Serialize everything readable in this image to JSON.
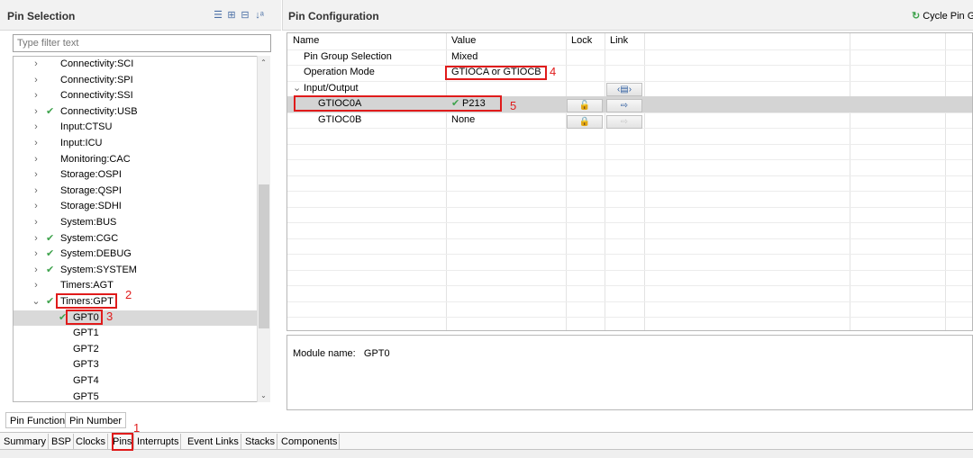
{
  "pin_selection": {
    "title": "Pin Selection",
    "toolbar_icons": [
      "collapse-all-icon",
      "expand-icon",
      "collapse-icon",
      "sort-az-icon"
    ],
    "filter_placeholder": "Type filter text",
    "tree": [
      {
        "label": "Connectivity:SCI",
        "expanded": false,
        "checked": false,
        "level": 0
      },
      {
        "label": "Connectivity:SPI",
        "expanded": false,
        "checked": false,
        "level": 0
      },
      {
        "label": "Connectivity:SSI",
        "expanded": false,
        "checked": false,
        "level": 0
      },
      {
        "label": "Connectivity:USB",
        "expanded": false,
        "checked": true,
        "level": 0
      },
      {
        "label": "Input:CTSU",
        "expanded": false,
        "checked": false,
        "level": 0
      },
      {
        "label": "Input:ICU",
        "expanded": false,
        "checked": false,
        "level": 0
      },
      {
        "label": "Monitoring:CAC",
        "expanded": false,
        "checked": false,
        "level": 0
      },
      {
        "label": "Storage:OSPI",
        "expanded": false,
        "checked": false,
        "level": 0
      },
      {
        "label": "Storage:QSPI",
        "expanded": false,
        "checked": false,
        "level": 0
      },
      {
        "label": "Storage:SDHI",
        "expanded": false,
        "checked": false,
        "level": 0
      },
      {
        "label": "System:BUS",
        "expanded": false,
        "checked": false,
        "level": 0
      },
      {
        "label": "System:CGC",
        "expanded": false,
        "checked": true,
        "level": 0
      },
      {
        "label": "System:DEBUG",
        "expanded": false,
        "checked": true,
        "level": 0
      },
      {
        "label": "System:SYSTEM",
        "expanded": false,
        "checked": true,
        "level": 0
      },
      {
        "label": "Timers:AGT",
        "expanded": false,
        "checked": false,
        "level": 0
      },
      {
        "label": "Timers:GPT",
        "expanded": true,
        "checked": true,
        "level": 0
      },
      {
        "label": "GPT0",
        "checked": true,
        "level": 1,
        "selected": true
      },
      {
        "label": "GPT1",
        "checked": false,
        "level": 1
      },
      {
        "label": "GPT2",
        "checked": false,
        "level": 1
      },
      {
        "label": "GPT3",
        "checked": false,
        "level": 1
      },
      {
        "label": "GPT4",
        "checked": false,
        "level": 1
      },
      {
        "label": "GPT5",
        "checked": false,
        "level": 1
      }
    ],
    "tabs": [
      "Pin Function",
      "Pin Number"
    ]
  },
  "pin_configuration": {
    "title": "Pin Configuration",
    "cycle_label": "Cycle Pin G",
    "columns": [
      "Name",
      "Value",
      "Lock",
      "Link"
    ],
    "rows": [
      {
        "name": "Pin Group Selection",
        "value": "Mixed"
      },
      {
        "name": "Operation Mode",
        "value": "GTIOCA or GTIOCB"
      },
      {
        "name": "Input/Output",
        "value": "",
        "group": true
      },
      {
        "name": "GTIOC0A",
        "value": "P213",
        "value_checked": true
      },
      {
        "name": "GTIOC0B",
        "value": "None"
      }
    ],
    "module_label": "Module name:",
    "module_value": "GPT0"
  },
  "editor_tabs": [
    "Summary",
    "BSP",
    "Clocks",
    "Pins",
    "Interrupts",
    "Event Links",
    "Stacks",
    "Components"
  ],
  "annotations": {
    "pins_tab": "1",
    "timers_gpt": "2",
    "gpt0": "3",
    "operation_mode": "4",
    "gtioc0a": "5"
  },
  "colors": {
    "annotation_red": "#e01b1b",
    "check_green": "#3fa34d",
    "selection_gray": "#d9d9d9"
  }
}
